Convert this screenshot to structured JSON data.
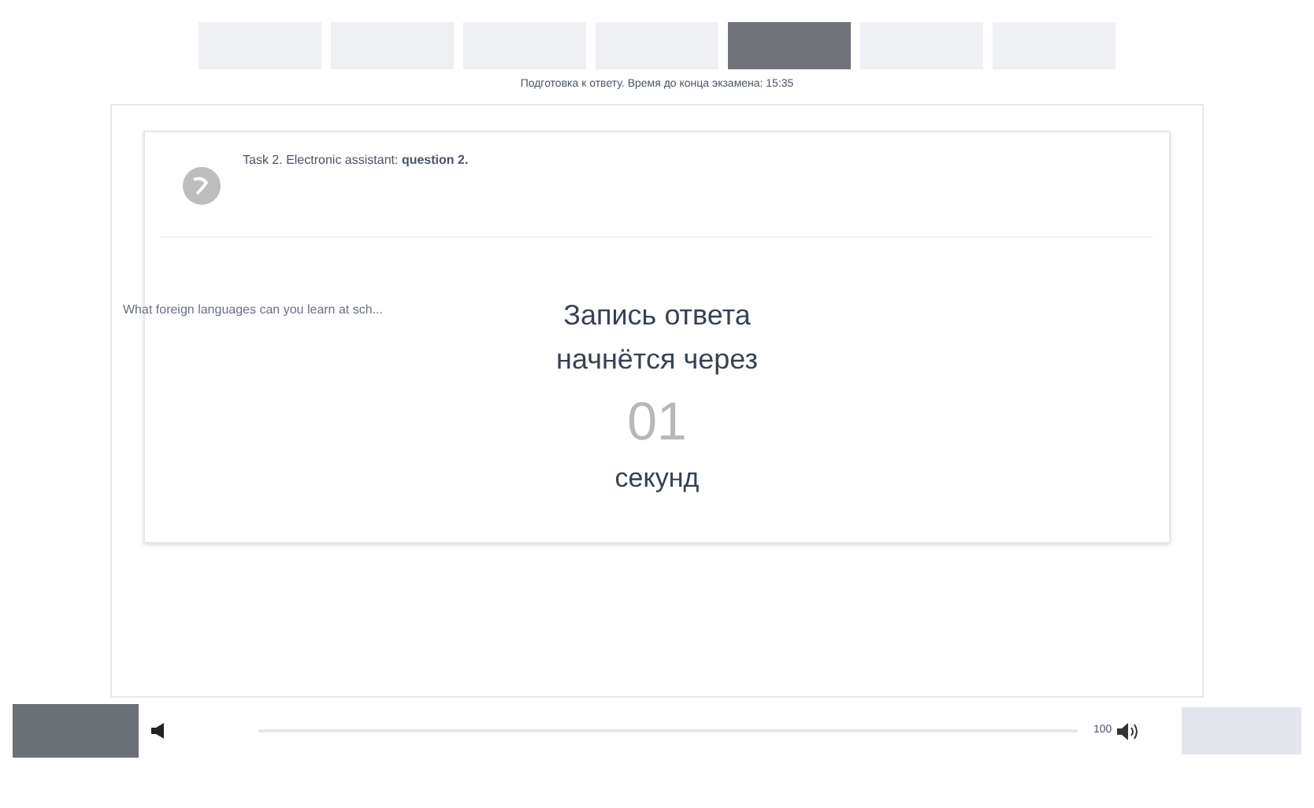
{
  "tabs": [
    {
      "selected": false
    },
    {
      "selected": false
    },
    {
      "selected": false
    },
    {
      "selected": false
    },
    {
      "selected": true
    },
    {
      "selected": false
    },
    {
      "selected": false
    }
  ],
  "timer_line": "Подготовка к ответу. Время до конца экзамена: 15:35",
  "task": {
    "title": "Task 2. Electronic assistant: **question 2.**",
    "question": "What foreign languages can you learn at sch..."
  },
  "countdown": {
    "line_1": "Запись ответа",
    "line_2": "начнётся через",
    "number": "01",
    "unit": "секунд"
  },
  "player": {
    "volume": "100"
  },
  "next_button": {
    "disabled": true
  }
}
